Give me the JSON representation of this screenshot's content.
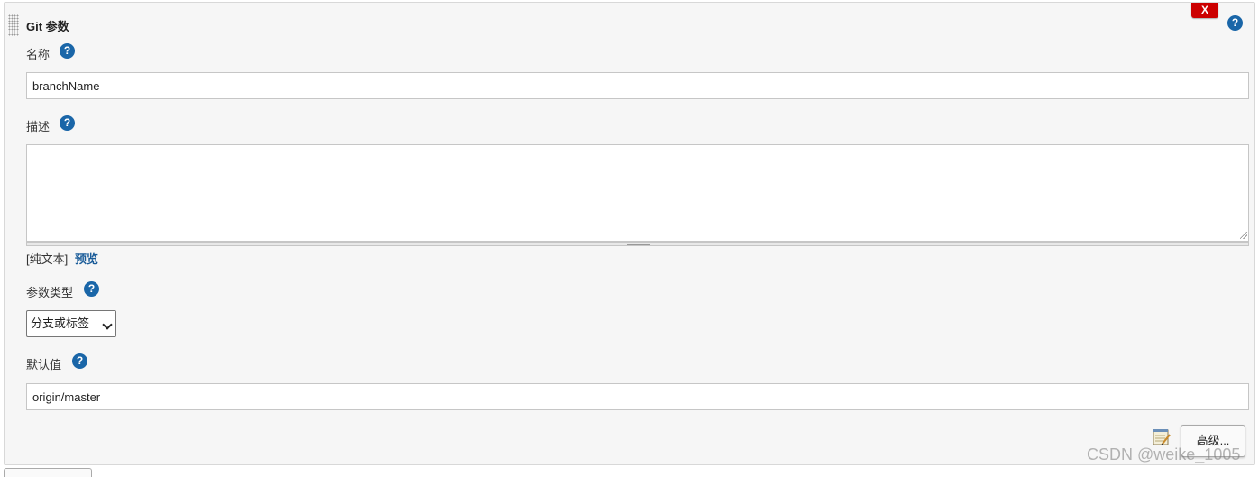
{
  "panel": {
    "title": "Git 参数",
    "delete_label": "X",
    "help_glyph": "?"
  },
  "name_field": {
    "label": "名称",
    "value": "branchName"
  },
  "description_field": {
    "label": "描述",
    "value": "",
    "plain_text_label": "[纯文本]",
    "preview_label": "预览"
  },
  "param_type_field": {
    "label": "参数类型",
    "selected": "分支或标签"
  },
  "default_field": {
    "label": "默认值",
    "value": "origin/master"
  },
  "advanced_button": {
    "label": "高级..."
  },
  "watermark": "CSDN @weike_1005",
  "colors": {
    "delete_red": "#cc0000",
    "help_blue": "#1a66a8",
    "link_blue": "#1a5c99"
  },
  "icons": [
    "drag-handle-icon",
    "help-icon",
    "notepad-icon",
    "chevron-down-icon"
  ]
}
